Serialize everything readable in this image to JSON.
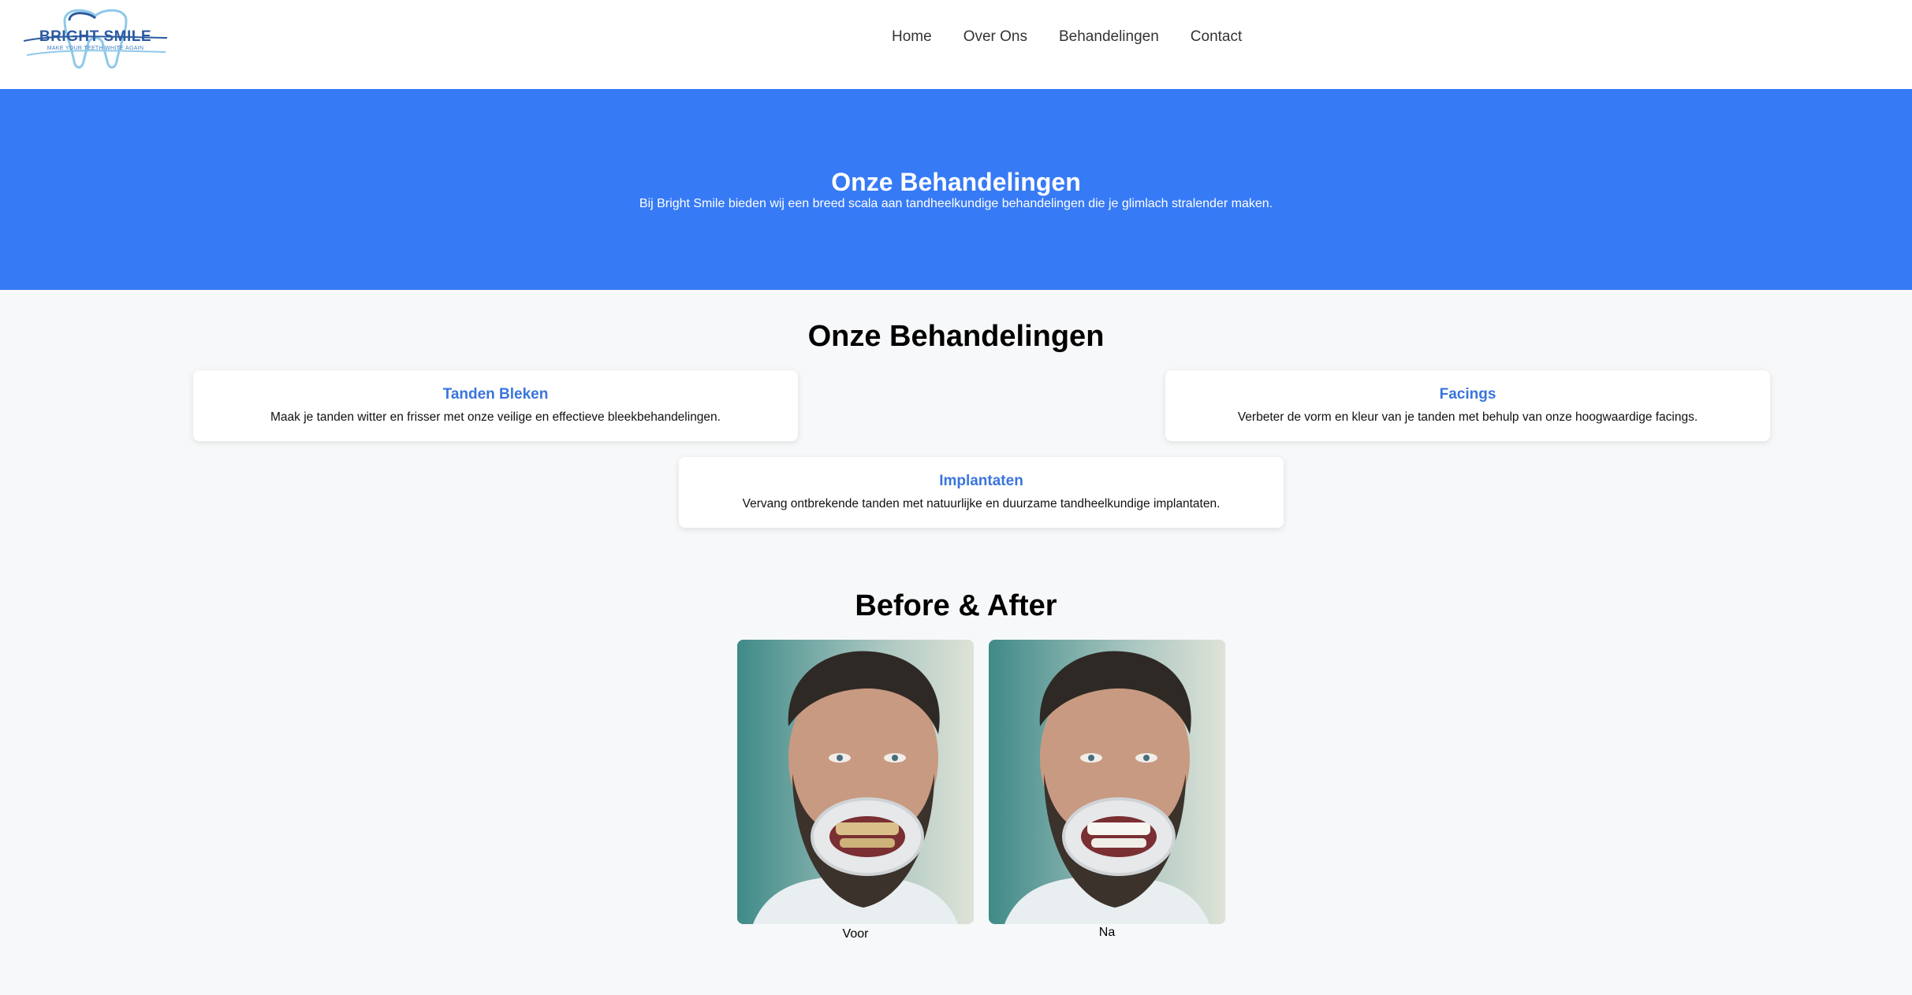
{
  "brand": {
    "name": "BRIGHT SMILE",
    "tagline": "MAKE YOUR TEETH WHITE AGAIN",
    "colors": {
      "logo_dark": "#2c5aa0",
      "logo_light": "#8ec9ea"
    }
  },
  "nav": {
    "items": [
      "Home",
      "Over Ons",
      "Behandelingen",
      "Contact"
    ]
  },
  "hero": {
    "title": "Onze Behandelingen",
    "subtitle": "Bij Bright Smile bieden wij een breed scala aan tandheelkundige behandelingen die je glimlach stralender maken.",
    "background": "#377af5"
  },
  "treatments": {
    "title": "Onze Behandelingen",
    "cards": [
      {
        "title": "Tanden Bleken",
        "description": "Maak je tanden witter en frisser met onze veilige en effectieve bleekbehandelingen."
      },
      {
        "title": "Facings",
        "description": "Verbeter de vorm en kleur van je tanden met behulp van onze hoogwaardige facings."
      },
      {
        "title": "Implantaten",
        "description": "Vervang ontbrekende tanden met natuurlijke en duurzame tandheelkundige implantaten."
      }
    ],
    "accent": "#3a75dc"
  },
  "before_after": {
    "title": "Before & After",
    "before_caption": "Voor",
    "after_caption": "Na"
  }
}
